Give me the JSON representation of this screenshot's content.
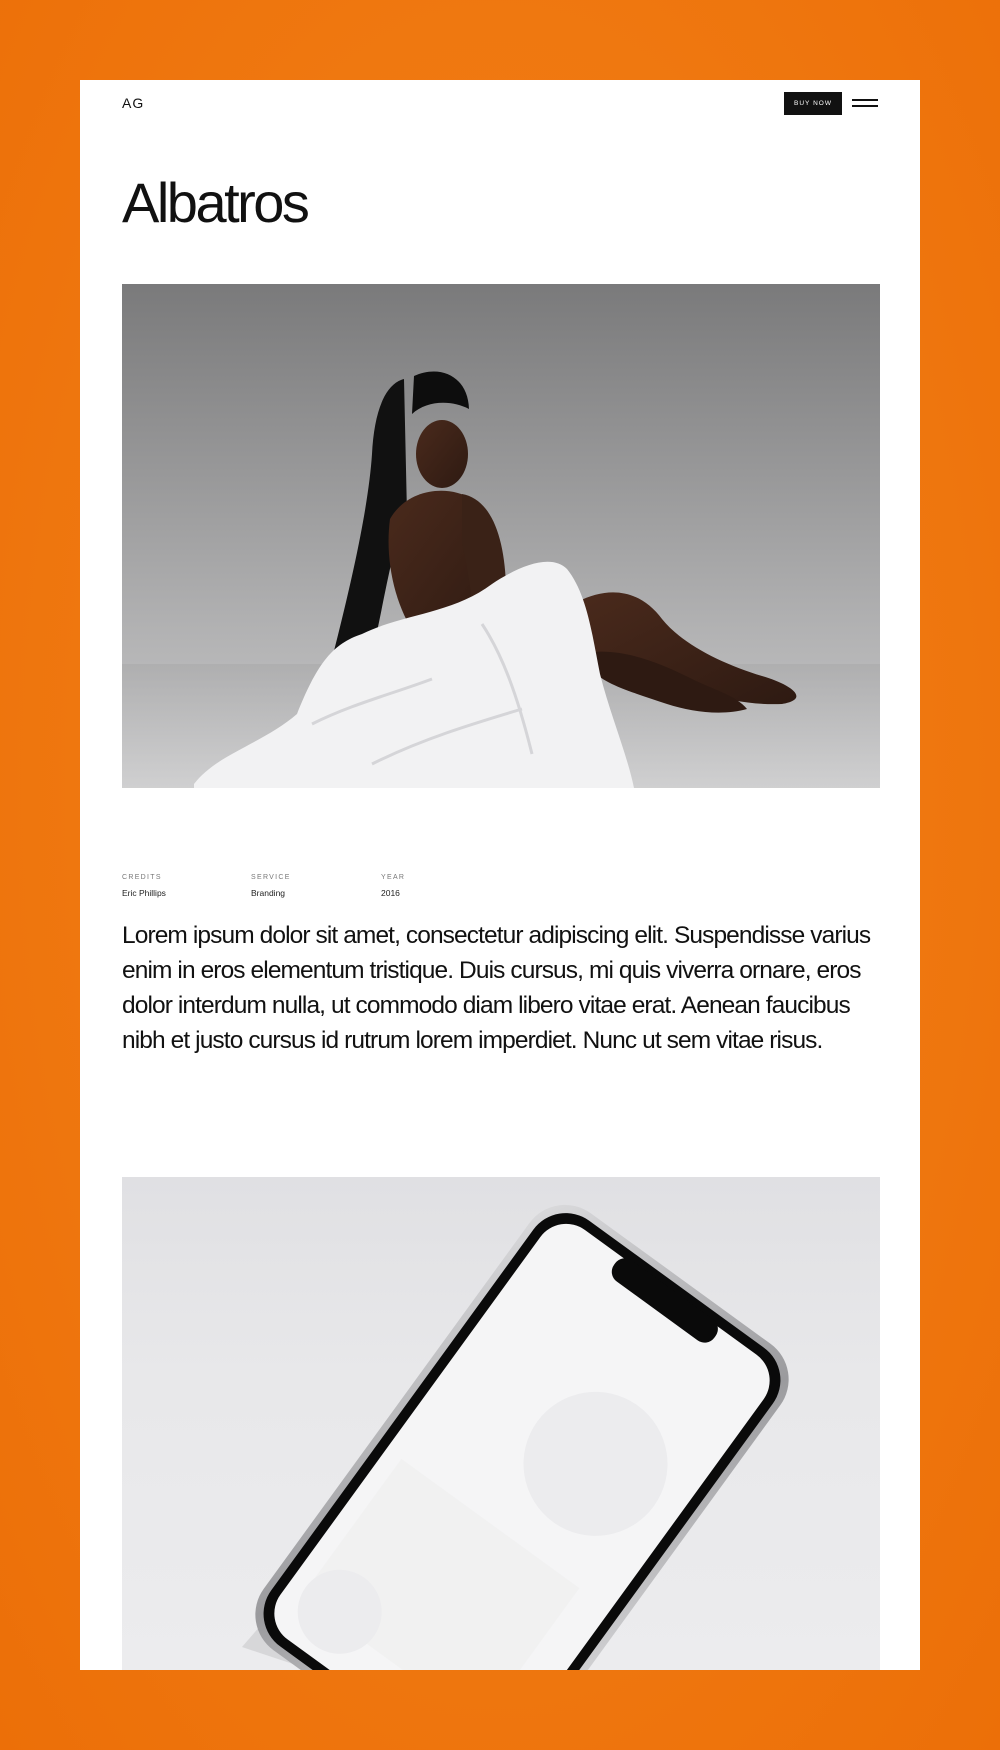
{
  "header": {
    "logo": "AG",
    "buy_now_label": "BUY NOW"
  },
  "project": {
    "title": "Albatros"
  },
  "meta": {
    "credits_label": "CREDITS",
    "credits_value": "Eric Phillips",
    "service_label": "SERVICE",
    "service_value": "Branding",
    "year_label": "YEAR",
    "year_value": "2016"
  },
  "description": "Lorem ipsum dolor sit amet, consectetur adipiscing elit. Suspendisse varius enim in eros elementum tristique. Duis cursus, mi quis viverra ornare, eros dolor interdum nulla, ut commodo diam libero vitae erat. Aenean faucibus nibh et justo cursus id rutrum lorem imperdiet. Nunc ut sem vitae risus.",
  "colors": {
    "background": "#f07a12",
    "card": "#ffffff",
    "text": "#111111",
    "button": "#111111"
  },
  "icons": {
    "menu": "hamburger-menu-icon"
  }
}
